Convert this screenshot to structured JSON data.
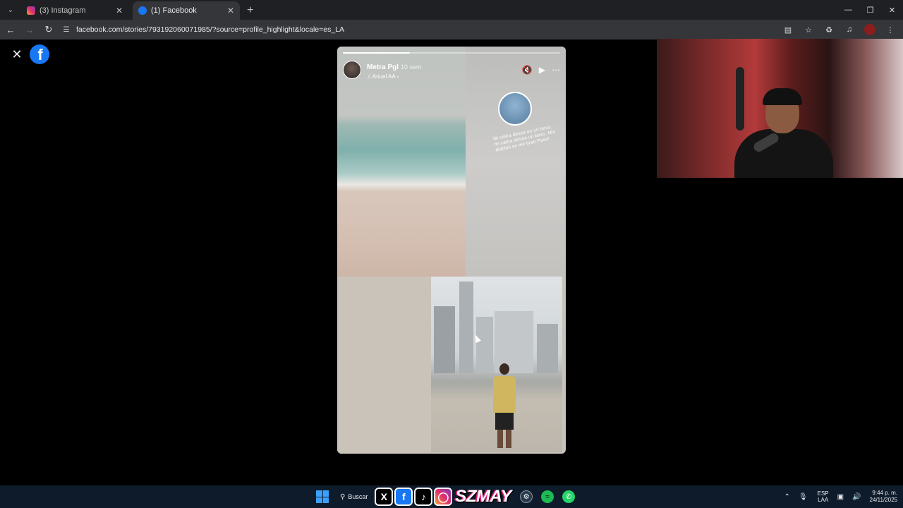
{
  "browser": {
    "tabs": [
      {
        "title": "(3) Instagram",
        "favicon": "instagram-icon",
        "active": false
      },
      {
        "title": "(1) Facebook",
        "favicon": "facebook-icon",
        "active": true
      }
    ],
    "url": "facebook.com/stories/793192060071985/?source=profile_highlight&locale=es_LA"
  },
  "story": {
    "author": "Metra Pgl",
    "time": "10 sem",
    "music": "Anuel AA",
    "progress_fraction": 0.31,
    "sticker_text": "Mi catira desea es un beso, mi catira desea un beso. Mis diablos se me tiran Pase!"
  },
  "taskbar": {
    "search_label": "Buscar",
    "brand_text": "SZMAY",
    "language_line1": "ESP",
    "language_line2": "LAA",
    "time": "9:44 p. m.",
    "date": "24/11/2025"
  },
  "colors": {
    "facebook_blue": "#1877f2",
    "page_bg": "#000000",
    "taskbar_bg": "#0e1b2b"
  }
}
